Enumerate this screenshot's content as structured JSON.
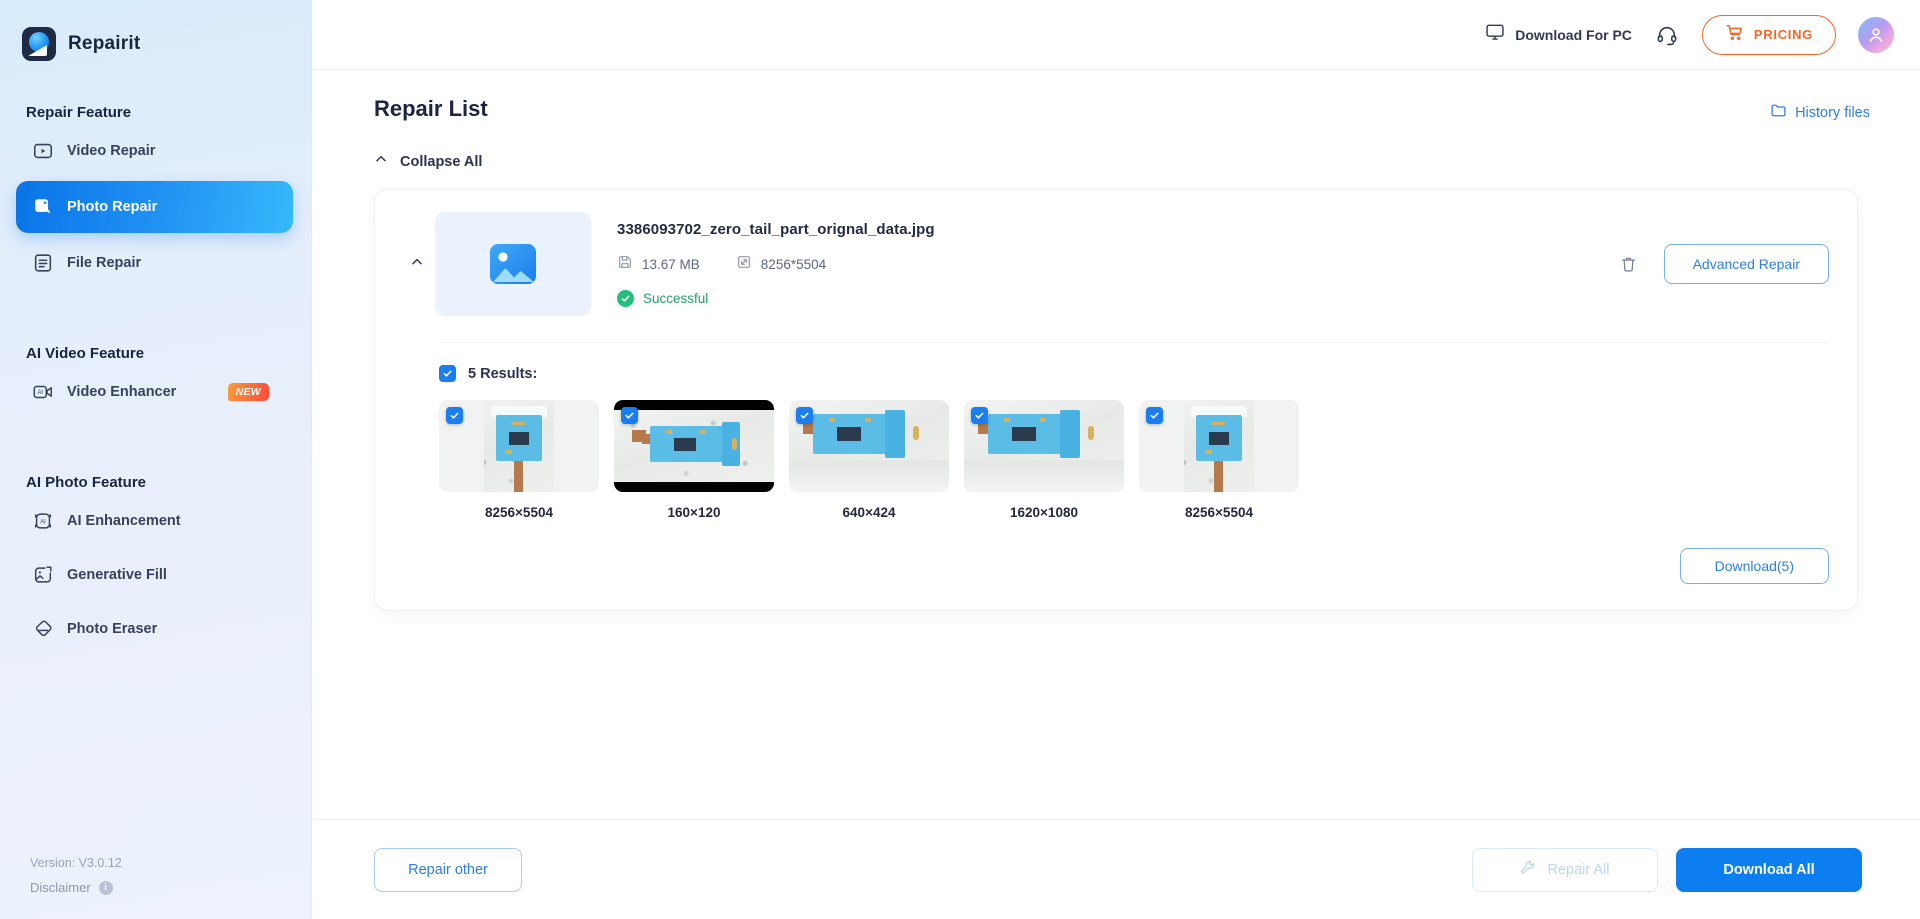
{
  "app": {
    "brand_name": "Repairit",
    "logo_icon": "repairit-logo-icon"
  },
  "sidebar": {
    "sections": [
      {
        "title": "Repair Feature",
        "items": [
          {
            "label": "Video Repair",
            "icon": "video-repair-icon",
            "active": false,
            "badge": ""
          },
          {
            "label": "Photo Repair",
            "icon": "photo-repair-icon",
            "active": true,
            "badge": ""
          },
          {
            "label": "File Repair",
            "icon": "file-repair-icon",
            "active": false,
            "badge": ""
          }
        ]
      },
      {
        "title": "AI Video Feature",
        "items": [
          {
            "label": "Video Enhancer",
            "icon": "video-enhancer-icon",
            "active": false,
            "badge": "NEW"
          }
        ]
      },
      {
        "title": "AI Photo Feature",
        "items": [
          {
            "label": "AI Enhancement",
            "icon": "ai-enhancement-icon",
            "active": false,
            "badge": ""
          },
          {
            "label": "Generative Fill",
            "icon": "generative-fill-icon",
            "active": false,
            "badge": ""
          },
          {
            "label": "Photo Eraser",
            "icon": "photo-eraser-icon",
            "active": false,
            "badge": ""
          }
        ]
      }
    ],
    "version": "Version: V3.0.12",
    "disclaimer": "Disclaimer",
    "disclaimer_icon": "info-icon"
  },
  "topbar": {
    "download_for_pc": "Download For PC",
    "monitor_icon": "monitor-icon",
    "support_icon": "headset-icon",
    "pricing": "PRICING",
    "cart_icon": "cart-icon",
    "avatar_icon": "user-avatar-icon",
    "accent_orange": "#f2682a"
  },
  "content": {
    "page_title": "Repair List",
    "history_files": "History files",
    "folder_icon": "folder-icon",
    "collapse_all": "Collapse All",
    "collapse_icon": "chevron-up-icon"
  },
  "file": {
    "name": "3386093702_zero_tail_part_orignal_data.jpg",
    "size": "13.67 MB",
    "size_icon": "floppy-save-icon",
    "resolution": "8256*5504",
    "resolution_icon": "resize-icon",
    "status": "Successful",
    "status_icon": "check-circle-icon",
    "status_color": "#22a06b",
    "collapse_icon": "chevron-up-icon",
    "thumbnail_icon": "image-placeholder-icon",
    "delete_icon": "trash-icon",
    "advanced_repair": "Advanced Repair"
  },
  "results": {
    "select_all_label": "5 Results:",
    "select_all_checked": true,
    "download_button": "Download(5)",
    "items": [
      {
        "caption": "8256×5504",
        "checked": true,
        "orientation": "portrait"
      },
      {
        "caption": "160×120",
        "checked": true,
        "orientation": "landscape-letterbox"
      },
      {
        "caption": "640×424",
        "checked": true,
        "orientation": "landscape"
      },
      {
        "caption": "1620×1080",
        "checked": true,
        "orientation": "landscape"
      },
      {
        "caption": "8256×5504",
        "checked": true,
        "orientation": "portrait"
      }
    ]
  },
  "footer": {
    "repair_other": "Repair other",
    "repair_all": "Repair All",
    "repair_all_icon": "wrench-icon",
    "repair_all_disabled": true,
    "download_all": "Download All",
    "primary_blue": "#0c7ef0"
  }
}
